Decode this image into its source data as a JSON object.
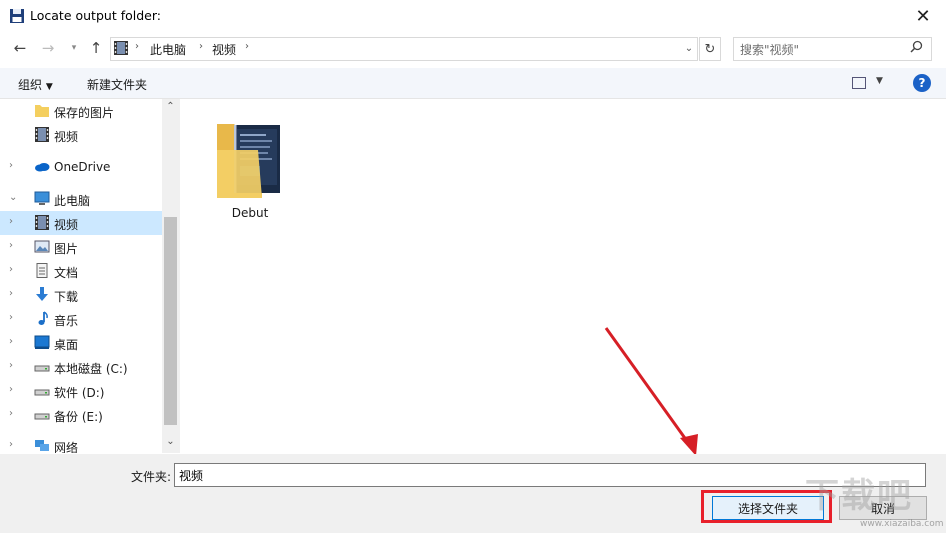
{
  "window": {
    "title": "Locate output folder:"
  },
  "nav": {
    "breadcrumb": [
      "此电脑",
      "视频"
    ],
    "search_placeholder": "搜索\"视频\""
  },
  "toolbar": {
    "organize": "组织",
    "new_folder": "新建文件夹"
  },
  "sidebar": {
    "items": [
      {
        "label": "保存的图片",
        "icon": "folder-icon",
        "selected": false,
        "chevron": false
      },
      {
        "label": "视频",
        "icon": "video-icon",
        "selected": false,
        "chevron": false
      },
      {
        "label": "OneDrive",
        "icon": "cloud-icon",
        "selected": false,
        "chevron": "right"
      },
      {
        "label": "此电脑",
        "icon": "computer-icon",
        "selected": false,
        "chevron": "down"
      },
      {
        "label": "视频",
        "icon": "video-icon",
        "selected": true,
        "chevron": "right"
      },
      {
        "label": "图片",
        "icon": "pictures-icon",
        "selected": false,
        "chevron": "right"
      },
      {
        "label": "文档",
        "icon": "documents-icon",
        "selected": false,
        "chevron": "right"
      },
      {
        "label": "下载",
        "icon": "download-icon",
        "selected": false,
        "chevron": "right"
      },
      {
        "label": "音乐",
        "icon": "music-icon",
        "selected": false,
        "chevron": "right"
      },
      {
        "label": "桌面",
        "icon": "desktop-icon",
        "selected": false,
        "chevron": "right"
      },
      {
        "label": "本地磁盘 (C:)",
        "icon": "drive-icon",
        "selected": false,
        "chevron": "right"
      },
      {
        "label": "软件 (D:)",
        "icon": "drive-icon",
        "selected": false,
        "chevron": "right"
      },
      {
        "label": "备份 (E:)",
        "icon": "drive-icon",
        "selected": false,
        "chevron": "right"
      },
      {
        "label": "网络",
        "icon": "network-icon",
        "selected": false,
        "chevron": "right"
      }
    ]
  },
  "content": {
    "folders": [
      {
        "name": "Debut"
      }
    ]
  },
  "footer": {
    "folder_label": "文件夹:",
    "folder_value": "视频",
    "select_button": "选择文件夹",
    "cancel_button": "取消"
  },
  "watermark": {
    "text": "下载吧",
    "url": "www.xiazaiba.com"
  },
  "colors": {
    "accent": "#0078d7",
    "selected": "#cce8ff",
    "highlight": "#e8202b",
    "arrow": "#d61f26"
  }
}
